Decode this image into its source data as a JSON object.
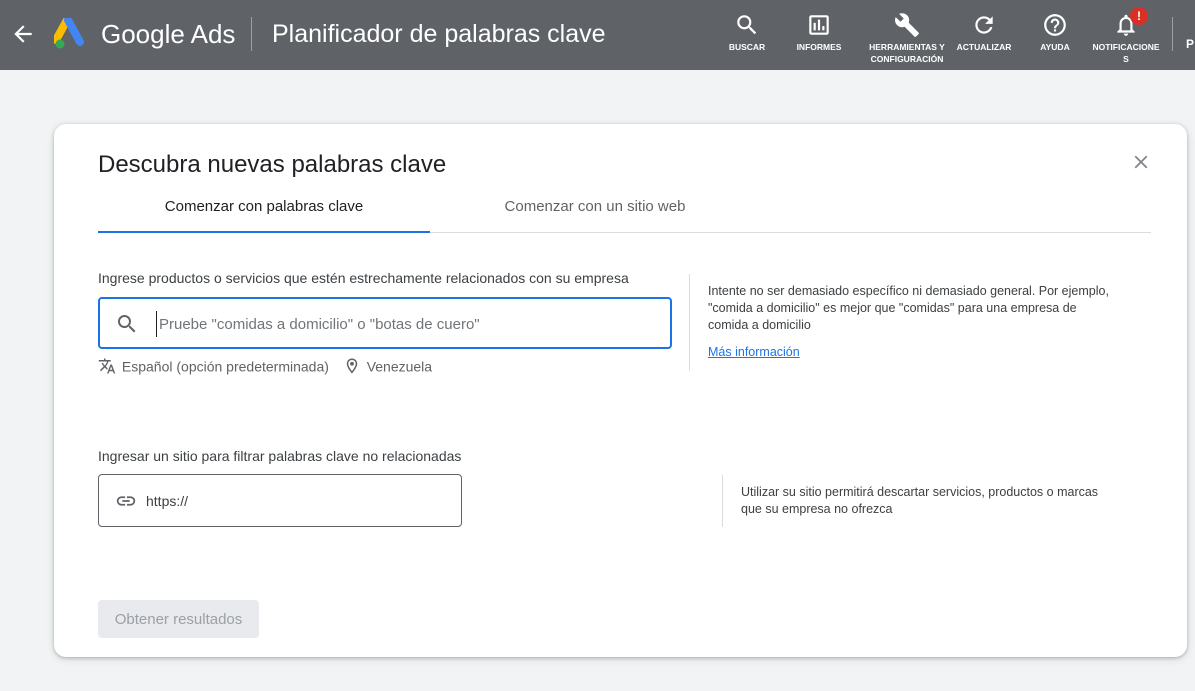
{
  "header": {
    "back_icon": "arrow-back-icon",
    "brand": "Google Ads",
    "title": "Planificador de palabras clave",
    "tools": [
      {
        "label": "BUSCAR",
        "icon": "search-icon"
      },
      {
        "label": "INFORMES",
        "icon": "reports-icon"
      },
      {
        "label": "HERRAMIENTAS Y CONFIGURACIÓN",
        "icon": "wrench-icon"
      },
      {
        "label": "ACTUALIZAR",
        "icon": "refresh-icon"
      },
      {
        "label": "AYUDA",
        "icon": "help-icon"
      },
      {
        "label": "NOTIFICACIONES",
        "icon": "bell-icon",
        "badge": "!"
      }
    ],
    "edge_text": "P",
    "colors": {
      "bar": "#5f6368",
      "badge": "#d93025"
    }
  },
  "dialog": {
    "title": "Descubra nuevas palabras clave",
    "close_icon": "close-icon",
    "tabs": [
      {
        "label": "Comenzar con palabras clave",
        "active": true
      },
      {
        "label": "Comenzar con un sitio web",
        "active": false
      }
    ],
    "keywords": {
      "label": "Ingrese productos o servicios que estén estrechamente relacionados con su empresa",
      "placeholder": "Pruebe \"comidas a domicilio\" o \"botas de cuero\"",
      "value": "",
      "language": "Español (opción predeterminada)",
      "location": "Venezuela",
      "hint": "Intente no ser demasiado específico ni demasiado general. Por ejemplo, \"comida a domicilio\" es mejor que \"comidas\" para una empresa de comida a domicilio",
      "link": "Más información"
    },
    "site_filter": {
      "label": "Ingresar un sitio para filtrar palabras clave no relacionadas",
      "value": "https://",
      "hint": "Utilizar su sitio permitirá descartar servicios, productos o marcas que su empresa no ofrezca"
    },
    "submit_label": "Obtener resultados",
    "colors": {
      "accent": "#1a73e8"
    }
  }
}
